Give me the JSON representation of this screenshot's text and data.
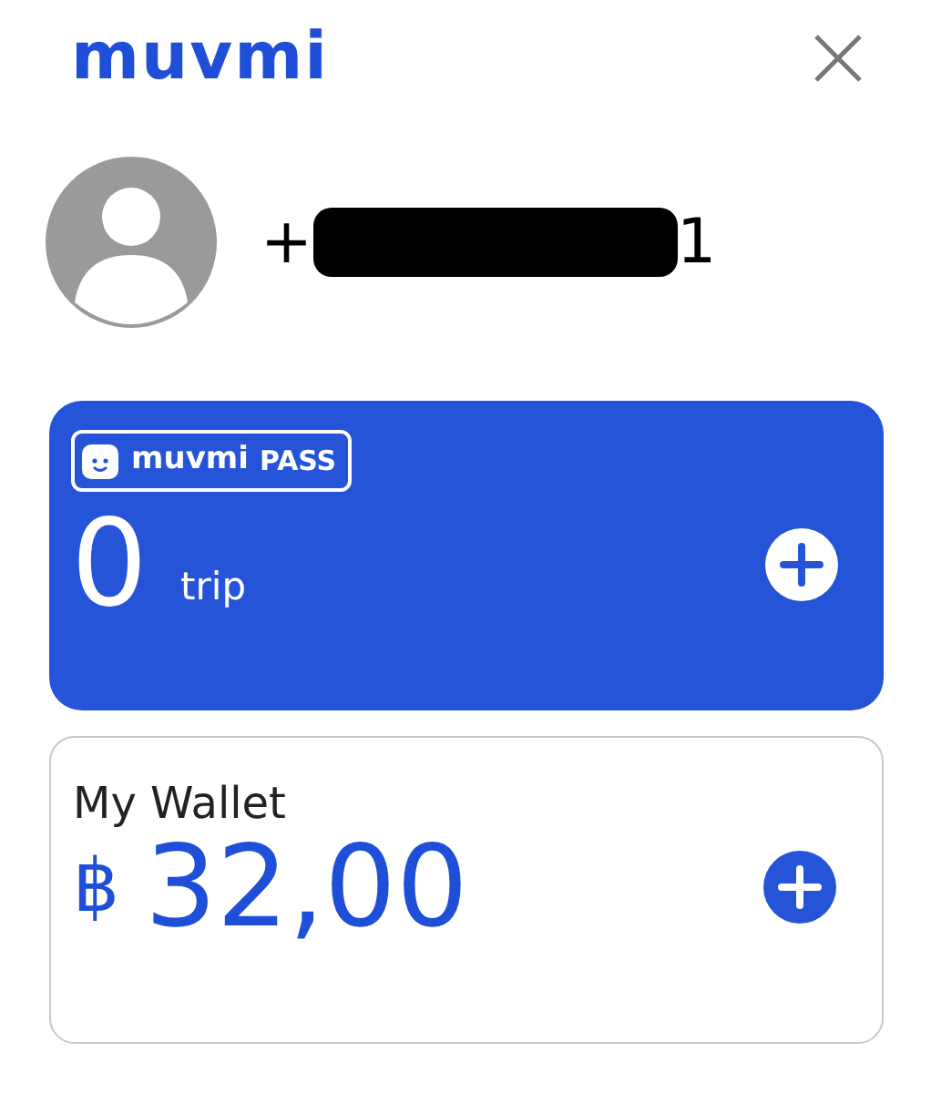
{
  "header": {
    "logo": "muvmi"
  },
  "profile": {
    "phone_prefix": "+",
    "phone_suffix": "1"
  },
  "pass_card": {
    "badge_logo": "muvmi",
    "badge_label": "PASS",
    "count": "0",
    "unit": "trip"
  },
  "wallet_card": {
    "title": "My Wallet",
    "currency": "฿",
    "amount": "32,00"
  }
}
